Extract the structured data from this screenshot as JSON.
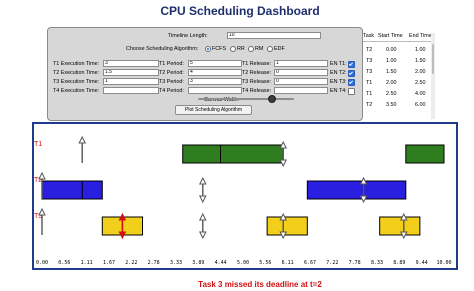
{
  "app": {
    "title": "CPU Scheduling Dashboard"
  },
  "controls": {
    "timeline_length_label": "Timeline Length:",
    "timeline_length_value": "10",
    "algorithm_label": "Choose Scheduling Algorithm:",
    "algorithms": [
      {
        "label": "FCFS",
        "selected": true
      },
      {
        "label": "RR",
        "selected": false
      },
      {
        "label": "RM",
        "selected": false
      },
      {
        "label": "EDF",
        "selected": false
      }
    ],
    "tasks": [
      {
        "exec_label": "T1 Execution Time:",
        "exec_value": "3",
        "period_label": "T1 Period:",
        "period_value": "5",
        "release_label": "T1 Release:",
        "release_value": "1",
        "en_label": "EN T1:",
        "enabled": true
      },
      {
        "exec_label": "T2 Execution Time:",
        "exec_value": "1.5",
        "period_label": "T2 Period:",
        "period_value": "4",
        "release_label": "T2 Release:",
        "release_value": "0",
        "en_label": "EN T2:",
        "enabled": true
      },
      {
        "exec_label": "T3 Execution Time:",
        "exec_value": "1",
        "period_label": "T3 Period:",
        "period_value": "3",
        "release_label": "T3 Release:",
        "release_value": "0",
        "en_label": "EN T3:",
        "enabled": true
      },
      {
        "exec_label": "T4 Execution Time:",
        "exec_value": "",
        "period_label": "T4 Period:",
        "period_value": "",
        "release_label": "T4 Release:",
        "release_value": "",
        "en_label": "EN T4:",
        "enabled": false
      }
    ],
    "canvas_width_label": "Canvas Width:",
    "canvas_width_fraction": 0.27,
    "plot_button_label": "Plot Scheduling Algorithm"
  },
  "task_table": {
    "headers": [
      "Task",
      "Start Time",
      "End Time"
    ],
    "rows": [
      [
        "T2",
        "0.00",
        "1.00"
      ],
      [
        "T3",
        "1.00",
        "1.50"
      ],
      [
        "T3",
        "1.50",
        "2.00"
      ],
      [
        "T1",
        "2.00",
        "2.50"
      ],
      [
        "T1",
        "2.50",
        "4.00"
      ],
      [
        "T2",
        "3.50",
        "6.00"
      ]
    ]
  },
  "timeline": {
    "task_labels": [
      "T1",
      "T2",
      "T3"
    ],
    "ticks": [
      "0.00",
      "0.56",
      "1.11",
      "1.67",
      "2.22",
      "2.78",
      "3.33",
      "3.89",
      "4.44",
      "5.00",
      "5.56",
      "6.11",
      "6.67",
      "7.22",
      "7.78",
      "8.33",
      "8.89",
      "9.44",
      "10.00"
    ],
    "x_range": [
      0,
      10
    ],
    "colors": {
      "T1": "#2e7d1f",
      "T2": "#2a1fe0",
      "T3": "#f2cf1a",
      "accent": "#1f3b8c",
      "alert": "#d01010"
    },
    "bars": [
      {
        "task": "T1",
        "start": 3.5,
        "end": 6.0
      },
      {
        "task": "T1",
        "start": 9.05,
        "end": 10.0
      },
      {
        "task": "T2",
        "start": 0.0,
        "end": 1.5
      },
      {
        "task": "T2",
        "start": 6.6,
        "end": 9.05
      },
      {
        "task": "T3",
        "start": 1.5,
        "end": 2.5
      },
      {
        "task": "T3",
        "start": 5.6,
        "end": 6.6
      },
      {
        "task": "T3",
        "start": 8.4,
        "end": 9.4
      }
    ],
    "dividers": [
      {
        "task": "T1",
        "at": 4.44
      },
      {
        "task": "T2",
        "at": 1.0
      }
    ],
    "up_arrows": [
      {
        "task": "T1",
        "at": 1.0
      },
      {
        "task": "T2",
        "at": 0.0
      },
      {
        "task": "T3",
        "at": 0.0
      }
    ],
    "double_arrows": [
      {
        "task": "T1",
        "at": 6.0
      },
      {
        "task": "T2",
        "at": 4.0
      },
      {
        "task": "T2",
        "at": 8.0
      },
      {
        "task": "T3",
        "at": 4.0
      },
      {
        "task": "T3",
        "at": 6.0
      },
      {
        "task": "T3",
        "at": 9.0
      }
    ],
    "missed_marker": {
      "task": "T3",
      "at": 2.0
    }
  },
  "status": {
    "message": "Task 3 missed its deadline at t=2"
  }
}
